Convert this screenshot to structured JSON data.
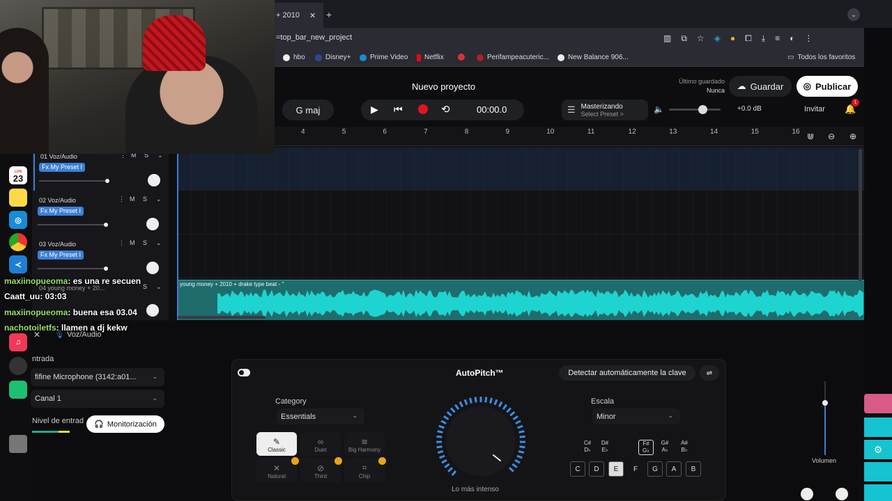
{
  "browser": {
    "tab_title": "+ 2010",
    "url": "=top_bar_new_project",
    "bookmarks": [
      "hbo",
      "Disney+",
      "Prime Video",
      "Netflix",
      "Perifampeacuteric...",
      "New Balance 906...",
      "Todos los favoritos"
    ]
  },
  "dock": {
    "calendar_day": "23",
    "calendar_month": "LUN"
  },
  "app": {
    "project_title": "Nuevo proyecto",
    "last_saved_label": "Último guardado",
    "last_saved_value": "Nunca",
    "save_label": "Guardar",
    "publish_label": "Publicar",
    "key": "G maj",
    "time": "00:00.0",
    "mastering_label": "Masterizando",
    "mastering_preset": "Select Preset >",
    "volume_db": "+0.0 dB",
    "invite_label": "Invitar",
    "notification_count": "1"
  },
  "ruler": {
    "ticks": [
      "4",
      "5",
      "6",
      "7",
      "8",
      "9",
      "10",
      "11",
      "12",
      "13",
      "14",
      "15",
      "16"
    ]
  },
  "tracks": [
    {
      "title": "01  Voz/Audio",
      "fx": "Fx My Preset I",
      "m": "M",
      "s": "S"
    },
    {
      "title": "02  Voz/Audio",
      "fx": "Fx My Preset I",
      "m": "M",
      "s": "S"
    },
    {
      "title": "03  Voz/Audio",
      "fx": "Fx My Preset I",
      "m": "M",
      "s": "S"
    },
    {
      "title": "04  young money + 20...",
      "fx": "",
      "m": "",
      "s": "S"
    }
  ],
  "clip_label": "young money + 2010 + drake type beat -  \"",
  "chat": [
    {
      "user": "maxiinopueoma",
      "msg": ": es una re secuen"
    },
    {
      "user": "Caatt_uu",
      "msg": ": 03:03"
    },
    {
      "user": "maxiinopueoma",
      "msg": ": buena esa 03.04"
    },
    {
      "user": "nachotoiletfs",
      "msg": ": llamen a dj kekw"
    }
  ],
  "input_panel": {
    "track_name": "Voz/Audio",
    "input_label": "ntrada",
    "microphone": "fifine Microphone (3142:a01...",
    "channel": "Canal 1",
    "input_level_label": "Nivel de entrad",
    "monitor_label": "Monitorización"
  },
  "autopitch": {
    "title": "AutoPitch™",
    "detect_key_label": "Detectar automáticamente la clave",
    "category_label": "Category",
    "category_value": "Essentials",
    "styles": [
      "Classic",
      "Duet",
      "Big Harmony",
      "Natural",
      "Third",
      "Chip"
    ],
    "knob_caption": "Lo más intenso",
    "scale_label": "Escala",
    "scale_value": "Minor",
    "sharps": [
      [
        "C#",
        "D♭"
      ],
      [
        "D#",
        "E♭"
      ],
      [
        "F#",
        "G♭"
      ],
      [
        "G#",
        "A♭"
      ],
      [
        "A#",
        "B♭"
      ]
    ],
    "keys": [
      "C",
      "D",
      "E",
      "F",
      "G",
      "A",
      "B"
    ],
    "volume_label": "Volumen"
  },
  "colors": {
    "accent_blue": "#3b7fd6",
    "clip_teal": "#1ed4d0",
    "record_red": "#e0141e"
  }
}
